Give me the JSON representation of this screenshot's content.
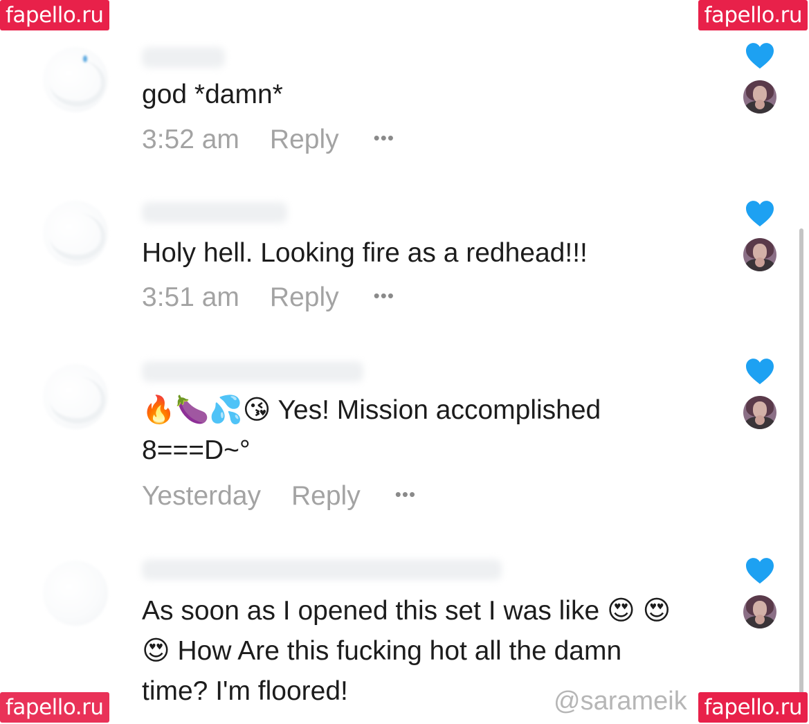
{
  "watermark": {
    "text": "fapello.ru",
    "color": "#e8214a"
  },
  "comments": [
    {
      "text": "god *damn*",
      "time": "3:52 am",
      "reply_label": "Reply",
      "more_label": "•••"
    },
    {
      "text": "Holy hell. Looking fire as a redhead!!!",
      "time": "3:51 am",
      "reply_label": "Reply",
      "more_label": "•••"
    },
    {
      "text": "🔥🍆💦😘 Yes! Mission accomplished 8===D~°",
      "time": "Yesterday",
      "reply_label": "Reply",
      "more_label": "•••"
    },
    {
      "text": "As soon as I opened this set I was like 😍 😍😍 How Are this fucking hot all the damn time? I'm floored!",
      "time": "",
      "reply_label": "",
      "more_label": ""
    }
  ],
  "handle": "@sarameik",
  "colors": {
    "heart": "#1da1f2",
    "meta_text": "#a3a3a3",
    "comment_text": "#1c1c1c"
  },
  "icons": {
    "heart": "heart-icon",
    "more": "more-options-icon",
    "liker_avatar": "creator-avatar"
  }
}
